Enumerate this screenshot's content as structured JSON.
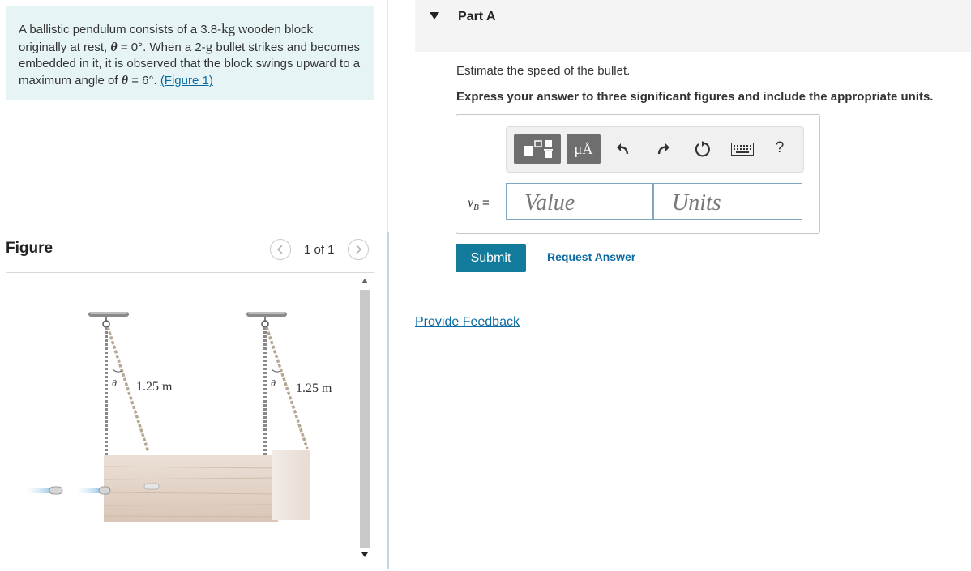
{
  "problem": {
    "text_1": "A ballistic pendulum consists of a 3.8-",
    "mass_unit": "kg",
    "text_2": " wooden block originally at rest, ",
    "theta": "θ",
    "text_3": " = 0°. When a 2-",
    "bullet_unit": "g",
    "text_4": " bullet strikes and becomes embedded in it, it is observed that the block swings upward to a maximum angle of ",
    "text_5": " = 6°. ",
    "figure_link": "(Figure 1)"
  },
  "figure": {
    "title": "Figure",
    "page_count": "1 of 1",
    "length_label_left": "1.25 m",
    "length_label_right": "1.25 m",
    "angle_label": "θ"
  },
  "part": {
    "title": "Part A",
    "question": "Estimate the speed of the bullet.",
    "instruction": "Express your answer to three significant figures and include the appropriate units."
  },
  "answer": {
    "variable_symbol": "v",
    "variable_subscript": "B",
    "equals": " =",
    "value_placeholder": "Value",
    "units_placeholder": "Units",
    "units_button_label": "μÅ",
    "help_label": "?"
  },
  "actions": {
    "submit_label": "Submit",
    "request_answer_label": "Request Answer",
    "feedback_label": "Provide Feedback"
  },
  "colors": {
    "problem_bg": "#e6f4f5",
    "link": "#0b6aa2",
    "submit_bg": "#127a9a",
    "toolbar_button_bg": "#6e6e6e"
  },
  "icons": [
    "chevron-left-icon",
    "chevron-right-icon",
    "caret-down-icon",
    "templates-icon",
    "undo-icon",
    "redo-icon",
    "reset-icon",
    "keyboard-icon",
    "help-icon",
    "scroll-up-icon",
    "scroll-down-icon"
  ]
}
